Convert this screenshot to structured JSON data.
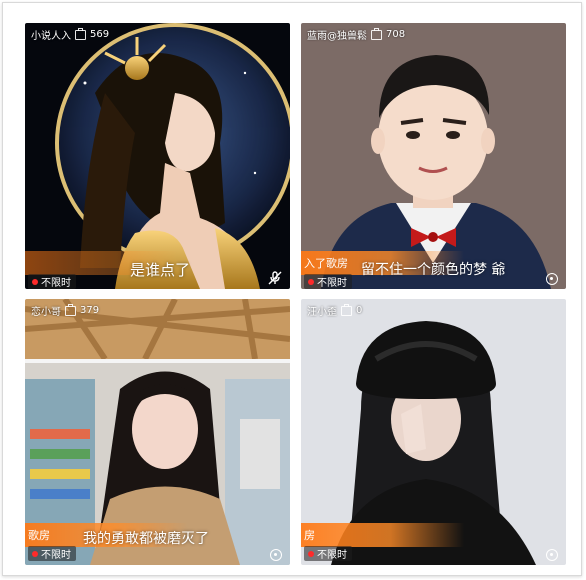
{
  "tiles": [
    {
      "streamer": "小说人入",
      "viewers": "569",
      "banner": "",
      "caption": "是谁点了",
      "badge": "不限时"
    },
    {
      "streamer": "蓝雨@独兽鬆",
      "viewers": "708",
      "banner": "入了歌房",
      "caption": "留不住一个颜色的梦 爺",
      "badge": "不限时"
    },
    {
      "streamer": "恋小哥",
      "viewers": "379",
      "banner": "歌房",
      "caption": "我的勇敢都被磨灭了",
      "badge": "不限时"
    },
    {
      "streamer": "汪小歪",
      "viewers": "0",
      "banner": "房",
      "caption": "",
      "badge": "不限时"
    }
  ],
  "colors": {
    "banner_orange": "#ff7a14",
    "live_dot": "#ff2a2a"
  },
  "icons": [
    "viewer-count-icon",
    "mic-off-icon",
    "record-icon"
  ]
}
